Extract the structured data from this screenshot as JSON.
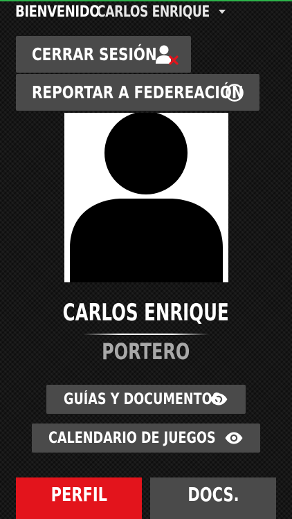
{
  "header": {
    "welcome_label": "BIENVENIDO",
    "user_name": "CARLOS ENRIQUE"
  },
  "actions": {
    "logout_label": "CERRAR SESIÓN",
    "report_label": "REPORTAR A FEDEREACIÓN"
  },
  "profile": {
    "name": "CARLOS ENRIQUE",
    "position": "PORTERO"
  },
  "links": {
    "guides_label": "GUÍAS Y DOCUMENTOS",
    "calendar_label": "CALENDARIO DE JUEGOS"
  },
  "tabs": [
    {
      "label": "PERFIL",
      "active": true
    },
    {
      "label": "DOCS.",
      "active": false
    }
  ],
  "colors": {
    "accent_red": "#e3141c",
    "button_gray": "#4a4a4a",
    "background": "#161616",
    "position_text": "#a8a8a8"
  }
}
